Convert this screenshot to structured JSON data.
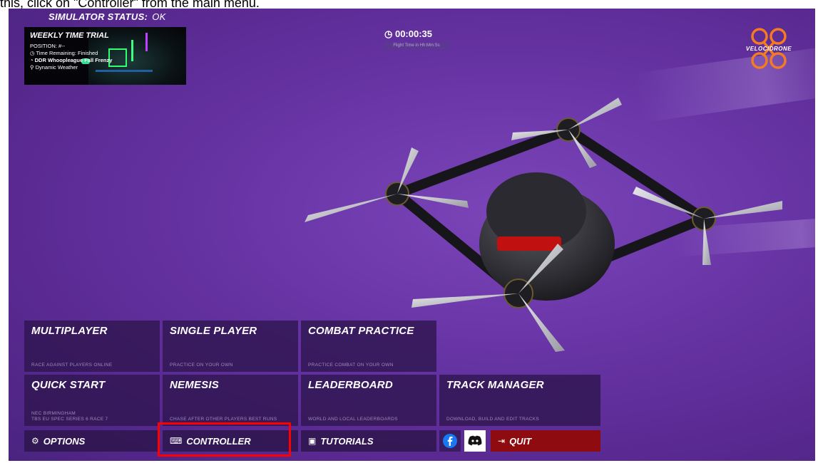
{
  "caption": "this, click on \"Controller\" from the main menu.",
  "status": {
    "label": "SIMULATOR STATUS:",
    "value": "OK"
  },
  "weekly_trial": {
    "title": "WEEKLY TIME TRIAL",
    "position": "POSITION: #--",
    "time_remaining": "Time Remaining: Finished",
    "track": "DDR Whoopleague Fall Frenzy",
    "weather": "Dynamic Weather"
  },
  "timer": {
    "value": "00:00:35",
    "subtitle": "Flight Time in Hh:Mm:Ss"
  },
  "logo": {
    "text": "VELOCIDRONE",
    "color": "#f47b20"
  },
  "tiles": {
    "multiplayer": {
      "title": "MULTIPLAYER",
      "desc": "RACE AGAINST PLAYERS ONLINE"
    },
    "single_player": {
      "title": "SINGLE PLAYER",
      "desc": "PRACTICE ON YOUR OWN"
    },
    "combat_practice": {
      "title": "COMBAT PRACTICE",
      "desc": "PRACTICE COMBAT ON YOUR OWN"
    },
    "quick_start": {
      "title": "QUICK START",
      "desc_line1": "NEC BIRMINGHAM",
      "desc_line2": "TBS EU SPEC SERIES 6 RACE 7"
    },
    "nemesis": {
      "title": "NEMESIS",
      "desc": "CHASE AFTER OTHER PLAYERS BEST RUNS"
    },
    "leaderboard": {
      "title": "LEADERBOARD",
      "desc": "WORLD AND LOCAL LEADERBOARDS"
    },
    "track_manager": {
      "title": "TRACK MANAGER",
      "desc": "DOWNLOAD, BUILD AND EDIT TRACKS"
    }
  },
  "buttons": {
    "options": "OPTIONS",
    "controller": "CONTROLLER",
    "tutorials": "TUTORIALS",
    "quit": "QUIT"
  },
  "icons": {
    "options": "gear-icon",
    "controller": "controller-icon",
    "tutorials": "tutorial-icon",
    "facebook": "facebook-icon",
    "discord": "discord-icon",
    "quit": "exit-icon"
  },
  "colors": {
    "background": "#6a36a8",
    "tile": "#301650",
    "quit": "#8e0c10",
    "highlight": "#ff0000",
    "facebook": "#1877f2",
    "discord": "#ffffff"
  }
}
